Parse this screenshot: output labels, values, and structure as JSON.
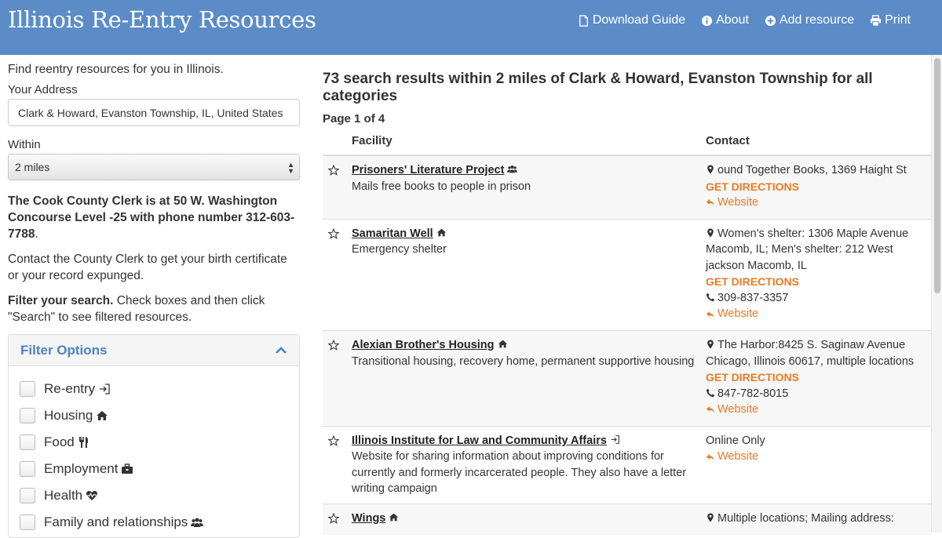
{
  "header": {
    "brand": "Illinois Re-Entry Resources",
    "nav": [
      {
        "label": "Download Guide",
        "icon": "file-icon"
      },
      {
        "label": "About",
        "icon": "info-icon"
      },
      {
        "label": "Add resource",
        "icon": "plus-circle-icon"
      },
      {
        "label": "Print",
        "icon": "print-icon"
      }
    ]
  },
  "sidebar": {
    "intro": "Find reentry resources for you in Illinois.",
    "address_label": "Your Address",
    "address_value": "Clark & Howard, Evanston Township, IL, United States",
    "within_label": "Within",
    "within_value": "2 miles",
    "clerk_notice": "The Cook County Clerk is at 50 W. Washington Concourse Level -25 with phone number 312-603-7788",
    "clerk_period": ".",
    "clerk_contact": "Contact the County Clerk to get your birth certificate or your record expunged.",
    "filter_intro_bold": "Filter your search.",
    "filter_intro_rest": " Check boxes and then click \"Search\" to see filtered resources.",
    "filter_title": "Filter Options",
    "filters": [
      {
        "label": "Re-entry",
        "icon": "sign-in-icon"
      },
      {
        "label": "Housing",
        "icon": "home-icon"
      },
      {
        "label": "Food",
        "icon": "utensils-icon"
      },
      {
        "label": "Employment",
        "icon": "briefcase-icon"
      },
      {
        "label": "Health",
        "icon": "heartbeat-icon"
      },
      {
        "label": "Family and relationships",
        "icon": "users-icon"
      }
    ]
  },
  "results": {
    "title": "73 search results within 2 miles of Clark & Howard, Evanston Township for all categories",
    "page_info": "Page 1 of 4",
    "col_facility": "Facility",
    "col_contact": "Contact",
    "directions_label": "GET DIRECTIONS",
    "website_label": "Website",
    "rows": [
      {
        "name": "Prisoners' Literature Project",
        "icon": "users-icon",
        "desc": "Mails free books to people in prison",
        "address": "ound Together Books, 1369 Haight St",
        "phone": ""
      },
      {
        "name": "Samaritan Well",
        "icon": "home-icon",
        "desc": "Emergency shelter",
        "address": "Women's shelter: 1306 Maple Avenue Macomb, IL; Men's shelter: 212 West jackson Macomb, IL",
        "phone": "309-837-3357"
      },
      {
        "name": "Alexian Brother's Housing",
        "icon": "home-icon",
        "desc": "Transitional housing, recovery home, permanent supportive housing",
        "address": "The Harbor:8425 S. Saginaw Avenue Chicago, Illinois 60617, multiple locations",
        "phone": "847-782-8015"
      },
      {
        "name": "Illinois Institute for Law and Community Affairs",
        "icon": "sign-in-icon",
        "desc": "Website for sharing information about improving conditions for currently and formerly incarcerated people. They also have a letter writing campaign",
        "online": "Online Only"
      },
      {
        "name": "Wings",
        "icon": "home-icon",
        "desc": "",
        "address": "Multiple locations; Mailing address:"
      }
    ]
  }
}
